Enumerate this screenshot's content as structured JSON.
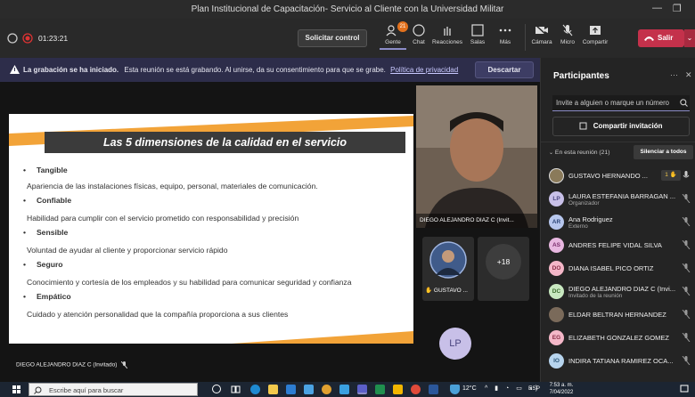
{
  "window": {
    "title": "Plan Institucional de Capacitación- Servicio al Cliente con la Universidad Militar",
    "minimize": "—",
    "maximize": "❐"
  },
  "toolbar": {
    "timer": "01:23:21",
    "request_control": "Solicitar control",
    "people_badge": "21",
    "buttons": [
      {
        "label": "Gente"
      },
      {
        "label": "Chat"
      },
      {
        "label": "Reacciones"
      },
      {
        "label": "Salas"
      },
      {
        "label": "Más"
      },
      {
        "label": "Cámara"
      },
      {
        "label": "Micro"
      },
      {
        "label": "Compartir"
      }
    ],
    "leave": "Salir"
  },
  "banner": {
    "bold": "La grabación se ha iniciado.",
    "text": "Esta reunión se está grabando. Al unirse, da su consentimiento para que se grabe.",
    "link": "Política de privacidad",
    "dismiss": "Descartar"
  },
  "slide": {
    "title": "Las 5 dimensiones de la calidad en el servicio",
    "items": [
      {
        "heading": "Tangible",
        "desc": "Apariencia de las instalaciones físicas, equipo, personal, materiales de comunicación."
      },
      {
        "heading": "Confiable",
        "desc": "Habilidad para cumplir con el servicio prometido con responsabilidad y precisión"
      },
      {
        "heading": "Sensible",
        "desc": "Voluntad de ayudar al cliente y proporcionar servicio rápido"
      },
      {
        "heading": "Seguro",
        "desc": "Conocimiento y cortesía de los empleados y su habilidad para comunicar seguridad y confianza"
      },
      {
        "heading": "Empático",
        "desc": "Cuidado y atención personalidad que la compañía proporciona a sus clientes"
      }
    ]
  },
  "video": {
    "main_name": "DIEGO ALEJANDRO DIAZ C (Invit...",
    "thumb_name": "GUSTAVO ...",
    "more_count": "+18",
    "lp_initials": "LP",
    "presenter_label": "DIEGO ALEJANDRO DIAZ C (Invitado)"
  },
  "panel": {
    "title": "Participantes",
    "invite_placeholder": "Invite a alguien o marque un número",
    "share_invite": "Compartir invitación",
    "in_meeting": "En esta reunión (21)",
    "mute_all": "Silenciar a todos",
    "participants": [
      {
        "name": "GUSTAVO HERNANDO ...",
        "initials": "",
        "sub": "",
        "color": "#8a7a5a",
        "raised": "1 ✋"
      },
      {
        "name": "LAURA ESTEFANIA BARRAGAN ...",
        "initials": "LP",
        "sub": "Organizador",
        "color": "#c8c0e8"
      },
      {
        "name": "Ana Rodriguez",
        "initials": "AR",
        "sub": "Externo",
        "color": "#b7c7ee"
      },
      {
        "name": "ANDRES FELIPE VIDAL SILVA",
        "initials": "AS",
        "sub": "",
        "color": "#e8b7e0"
      },
      {
        "name": "DIANA ISABEL PICO ORTIZ",
        "initials": "DO",
        "sub": "",
        "color": "#f4b7c8"
      },
      {
        "name": "DIEGO ALEJANDRO DIAZ C (Invi...",
        "initials": "DC",
        "sub": "Invitado de la reunión",
        "color": "#c8e8c0"
      },
      {
        "name": "ELDAR BELTRAN HERNANDEZ",
        "initials": "",
        "sub": "",
        "color": "#7a6a5a"
      },
      {
        "name": "ELIZABETH GONZALEZ GOMEZ",
        "initials": "EG",
        "sub": "",
        "color": "#f4b7c8"
      },
      {
        "name": "INDIRA TATIANA RAMIREZ OCA...",
        "initials": "IO",
        "sub": "",
        "color": "#b7d4ee"
      }
    ]
  },
  "taskbar": {
    "search_placeholder": "Escribe aquí para buscar",
    "temperature": "12°C",
    "lang": "ESP",
    "time": "7:53 a. m.",
    "date": "7/04/2022"
  }
}
